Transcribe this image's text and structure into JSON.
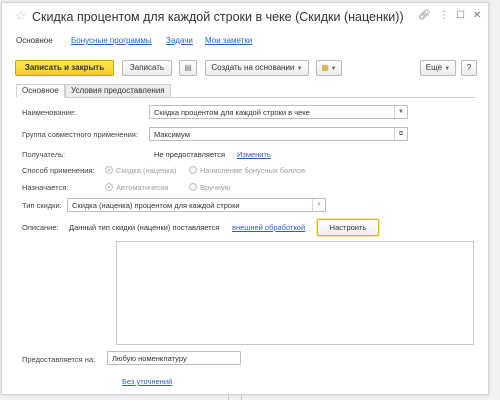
{
  "window": {
    "title": "Скидка процентом для каждой строки в чеке (Скидки (наценки))"
  },
  "nav_tabs": [
    {
      "label": "Основное"
    },
    {
      "label": "Бонусные программы"
    },
    {
      "label": "Задачи"
    },
    {
      "label": "Мои заметки"
    }
  ],
  "toolbar": {
    "save_close_label": "Записать и закрыть",
    "save_label": "Записать",
    "create_based_label": "Создать на основании",
    "more_label": "Еще",
    "help_label": "?"
  },
  "form_tabs": [
    {
      "label": "Основное"
    },
    {
      "label": "Условия предоставления"
    }
  ],
  "form": {
    "name_label": "Наименование:",
    "name_value": "Скидка процентом для каждой строки в чеке",
    "group_label": "Группа совместного применения:",
    "group_value": "Максимум",
    "recipient_label": "Получатель:",
    "recipient_value": "Не предоставляется",
    "recipient_change": "Изменить",
    "method_label": "Способ применения:",
    "method_option1": "Скидка (наценка)",
    "method_option2": "Начисление бонусных баллов",
    "assigned_label": "Назначается:",
    "assigned_option1": "Автоматически",
    "assigned_option2": "Вручную",
    "type_label": "Тип скидки:",
    "type_value": "Скидка (наценка) процентом для каждой строки",
    "desc_label": "Описание:",
    "desc_text": "Данный тип скидки (наценки) поставляется",
    "desc_link": "внешней обработкой",
    "setup_button": "Настроить",
    "provided_label": "Предоставляется на:",
    "provided_value": "Любую номенклатуру",
    "no_refinement": "Без уточнений"
  },
  "colors": {
    "accent": "#f5cd1e",
    "link": "#2c5fbd"
  }
}
